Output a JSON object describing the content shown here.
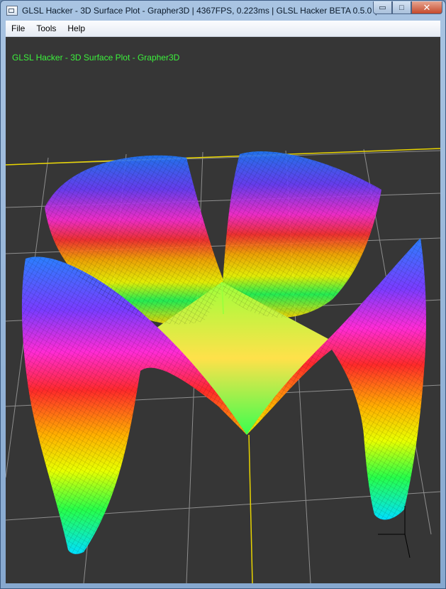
{
  "window": {
    "title": "GLSL Hacker - 3D Surface Plot - Grapher3D | 4367FPS, 0.223ms | GLSL Hacker BETA 0.5.0 (...",
    "controls": {
      "minimize": "▭",
      "maximize": "□",
      "close": "✕"
    }
  },
  "menu": {
    "items": [
      {
        "label": "File"
      },
      {
        "label": "Tools"
      },
      {
        "label": "Help"
      }
    ]
  },
  "viewport": {
    "overlay_title": "GLSL Hacker - 3D Surface Plot - Grapher3D",
    "overlay_color": "#3cf23c",
    "background": "#363636"
  },
  "icons": [
    "app-icon",
    "minimize-icon",
    "maximize-icon",
    "close-icon",
    "axis-gizmo-icon"
  ]
}
